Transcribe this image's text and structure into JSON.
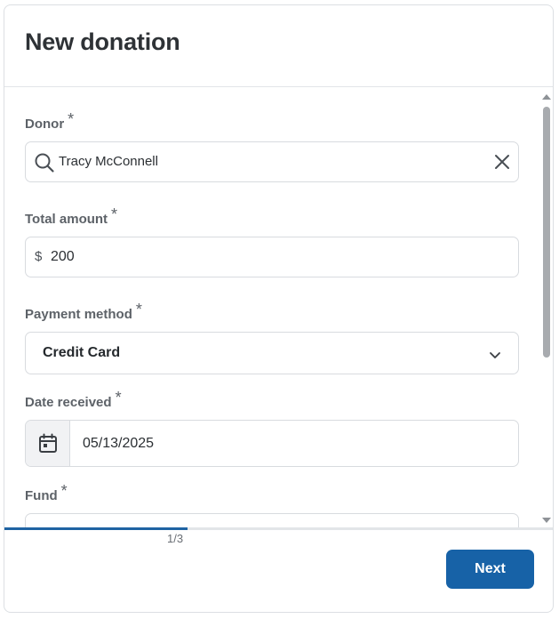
{
  "dialog": {
    "title": "New donation"
  },
  "form": {
    "required_marker": "*",
    "donor": {
      "label": "Donor",
      "value": "Tracy McConnell"
    },
    "total_amount": {
      "label": "Total amount",
      "currency_symbol": "$",
      "value": "200"
    },
    "payment_method": {
      "label": "Payment method",
      "value": "Credit Card"
    },
    "date_received": {
      "label": "Date received",
      "value": "05/13/2025"
    },
    "fund": {
      "label": "Fund",
      "value": ""
    }
  },
  "progress": {
    "step_text": "1/3",
    "fraction": 0.333,
    "color": "#1f63a3"
  },
  "footer": {
    "next_label": "Next"
  },
  "colors": {
    "primary": "#1762a7"
  },
  "icons": {
    "donor_search": "search-icon",
    "donor_clear": "clear-icon",
    "payment_dropdown": "chevron-down-icon",
    "date": "calendar-icon"
  }
}
